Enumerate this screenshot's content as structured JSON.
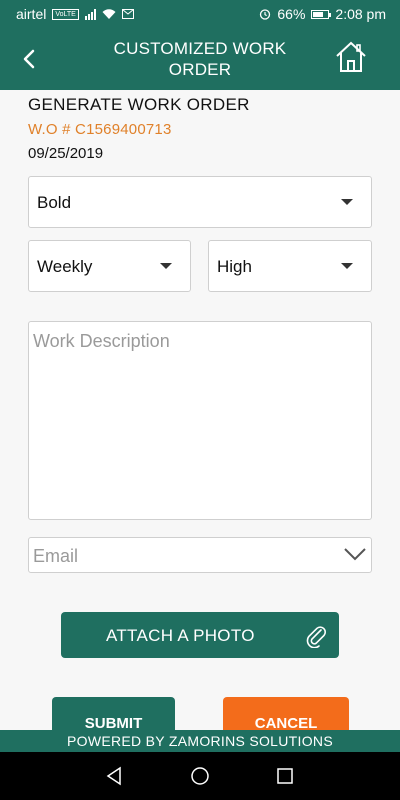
{
  "status_bar": {
    "carrier": "airtel",
    "network_badge": "VoLTE",
    "battery": "66%",
    "time": "2:08 pm",
    "icons": [
      "signal-icon",
      "wifi-icon",
      "mail-icon",
      "alarm-icon",
      "battery-icon"
    ],
    "battery_level": 0.66
  },
  "header": {
    "title": "CUSTOMIZED WORK ORDER",
    "back_icon": "back-arrow-icon",
    "home_icon": "home-icon"
  },
  "form": {
    "heading": "GENERATE WORK ORDER",
    "wo_number": "W.O # C1569400713",
    "date": "09/25/2019",
    "category_select": "Bold",
    "frequency_select": "Weekly",
    "priority_select": "High",
    "description_placeholder": "Work Description",
    "email_placeholder": "Email",
    "attach_label": "ATTACH A PHOTO",
    "submit_label": "SUBMIT",
    "cancel_label": "CANCEL"
  },
  "footer": {
    "text": "POWERED BY ZAMORINS SOLUTIONS"
  },
  "colors": {
    "primary": "#1f6f60",
    "accent_orange": "#f36c1b",
    "wo_text": "#e0812a"
  }
}
